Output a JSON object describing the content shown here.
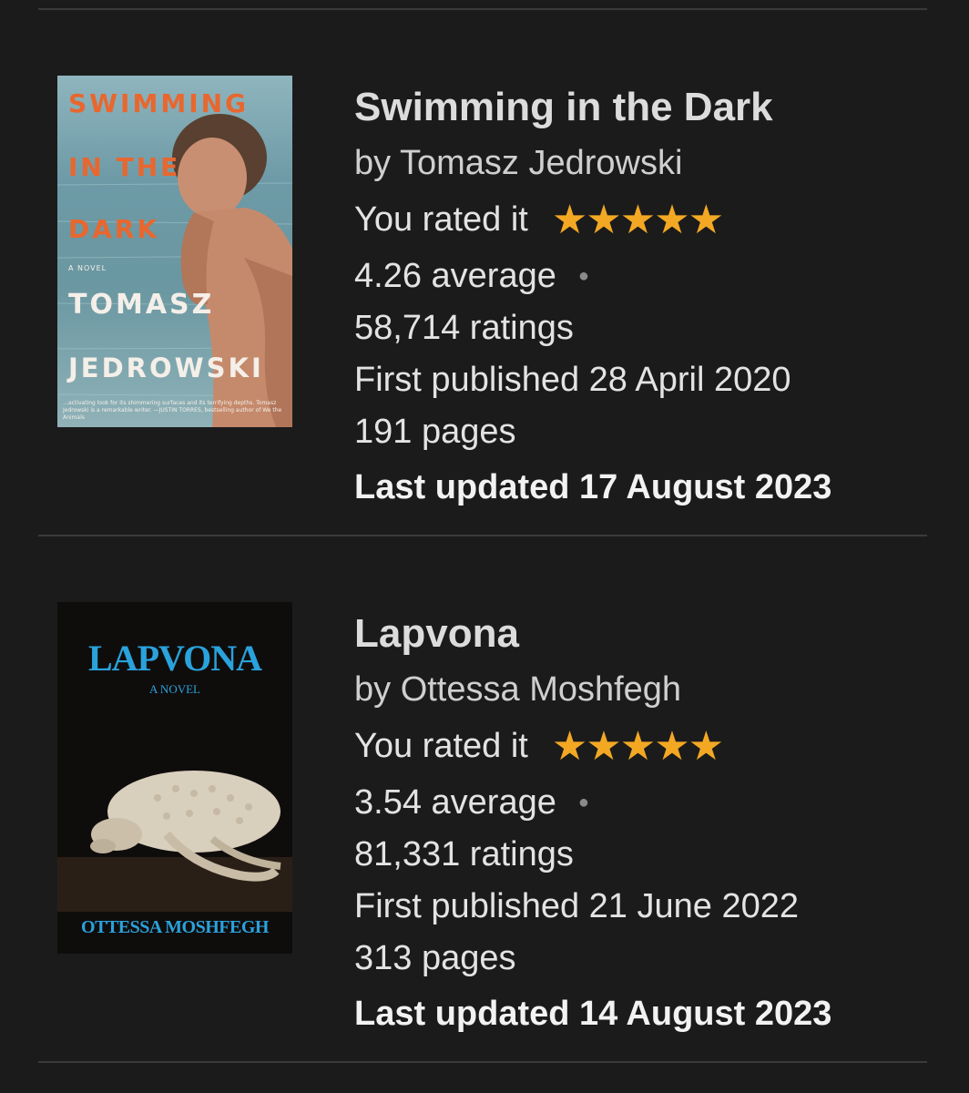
{
  "books": [
    {
      "title": "Swimming in the Dark",
      "author": "by Tomasz Jedrowski",
      "rated_label": "You rated it",
      "stars": "★★★★★",
      "user_rating": 5,
      "average": "4.26 average",
      "ratings": "58,714 ratings",
      "first_published": "First published 28 April 2020",
      "pages": "191 pages",
      "last_updated": "Last updated 17 August 2023",
      "cover": {
        "title_line1": "SWIMMING",
        "title_line2": "IN THE",
        "title_line3": "DARK",
        "tagline": "A NOVEL",
        "author_line1": "TOMASZ",
        "author_line2": "JEDROWSKI",
        "blurb": "…activating look for its shimmering surfaces and its terrifying depths. Tomasz Jedrowski is a remarkable writer. —JUSTIN TORRES, bestselling author of We the Animals"
      }
    },
    {
      "title": "Lapvona",
      "author": "by Ottessa Moshfegh",
      "rated_label": "You rated it",
      "stars": "★★★★★",
      "user_rating": 5,
      "average": "3.54 average",
      "ratings": "81,331 ratings",
      "first_published": "First published 21 June 2022",
      "pages": "313 pages",
      "last_updated": "Last updated 14 August 2023",
      "cover": {
        "title": "LAPVONA",
        "tagline": "A NOVEL",
        "author": "OTTESSA MOSHFEGH"
      }
    }
  ],
  "colors": {
    "background": "#1b1b1b",
    "divider": "#3a3a3a",
    "star": "#f3a824",
    "lapvona_blue": "#2aa2dc",
    "swimming_orange": "#e8672f"
  },
  "icons": {
    "star": "star-icon",
    "separator": "dot-separator-icon"
  }
}
